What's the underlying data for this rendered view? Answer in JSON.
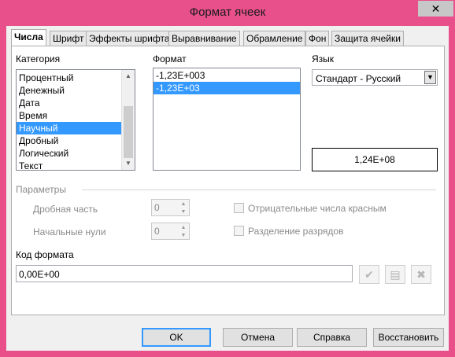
{
  "window": {
    "title": "Формат ячеек",
    "close_glyph": "✕"
  },
  "tabs": [
    {
      "label": "Числа",
      "active": true
    },
    {
      "label": "Шрифт"
    },
    {
      "label": "Эффекты шрифта"
    },
    {
      "label": "Выравнивание"
    },
    {
      "label": "Обрамление"
    },
    {
      "label": "Фон"
    },
    {
      "label": "Защита ячейки"
    }
  ],
  "category": {
    "label": "Категория",
    "items": [
      "Процентный",
      "Денежный",
      "Дата",
      "Время",
      "Научный",
      "Дробный",
      "Логический",
      "Текст"
    ],
    "selected": "Научный"
  },
  "format": {
    "label": "Формат",
    "items": [
      "-1,23E+003",
      "-1,23E+03"
    ],
    "selected": "-1,23E+03"
  },
  "language": {
    "label": "Язык",
    "value": "Стандарт - Русский"
  },
  "preview": {
    "value": "1,24E+08"
  },
  "options": {
    "label": "Параметры",
    "decimal_places": {
      "label": "Дробная часть",
      "value": "0"
    },
    "leading_zeros": {
      "label": "Начальные нули",
      "value": "0"
    },
    "negative_red": {
      "label": "Отрицательные числа красным",
      "checked": false
    },
    "thousands_sep": {
      "label": "Разделение разрядов",
      "checked": false
    }
  },
  "format_code": {
    "label": "Код формата",
    "value": "0,00E+00"
  },
  "buttons": {
    "ok": "OK",
    "cancel": "Отмена",
    "help": "Справка",
    "reset": "Восстановить"
  }
}
